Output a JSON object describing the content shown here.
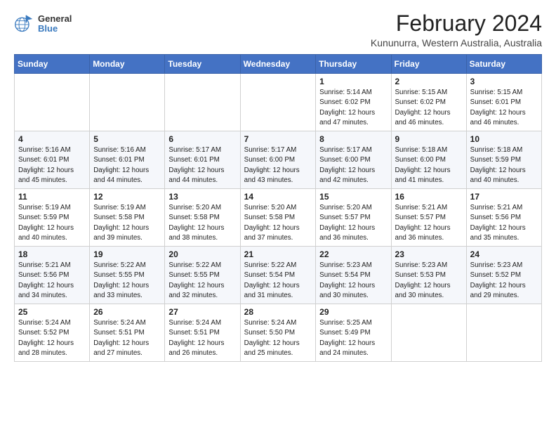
{
  "logo": {
    "line1": "General",
    "line2": "Blue"
  },
  "title": "February 2024",
  "subtitle": "Kununurra, Western Australia, Australia",
  "weekdays": [
    "Sunday",
    "Monday",
    "Tuesday",
    "Wednesday",
    "Thursday",
    "Friday",
    "Saturday"
  ],
  "weeks": [
    [
      {
        "day": "",
        "info": ""
      },
      {
        "day": "",
        "info": ""
      },
      {
        "day": "",
        "info": ""
      },
      {
        "day": "",
        "info": ""
      },
      {
        "day": "1",
        "info": "Sunrise: 5:14 AM\nSunset: 6:02 PM\nDaylight: 12 hours\nand 47 minutes."
      },
      {
        "day": "2",
        "info": "Sunrise: 5:15 AM\nSunset: 6:02 PM\nDaylight: 12 hours\nand 46 minutes."
      },
      {
        "day": "3",
        "info": "Sunrise: 5:15 AM\nSunset: 6:01 PM\nDaylight: 12 hours\nand 46 minutes."
      }
    ],
    [
      {
        "day": "4",
        "info": "Sunrise: 5:16 AM\nSunset: 6:01 PM\nDaylight: 12 hours\nand 45 minutes."
      },
      {
        "day": "5",
        "info": "Sunrise: 5:16 AM\nSunset: 6:01 PM\nDaylight: 12 hours\nand 44 minutes."
      },
      {
        "day": "6",
        "info": "Sunrise: 5:17 AM\nSunset: 6:01 PM\nDaylight: 12 hours\nand 44 minutes."
      },
      {
        "day": "7",
        "info": "Sunrise: 5:17 AM\nSunset: 6:00 PM\nDaylight: 12 hours\nand 43 minutes."
      },
      {
        "day": "8",
        "info": "Sunrise: 5:17 AM\nSunset: 6:00 PM\nDaylight: 12 hours\nand 42 minutes."
      },
      {
        "day": "9",
        "info": "Sunrise: 5:18 AM\nSunset: 6:00 PM\nDaylight: 12 hours\nand 41 minutes."
      },
      {
        "day": "10",
        "info": "Sunrise: 5:18 AM\nSunset: 5:59 PM\nDaylight: 12 hours\nand 40 minutes."
      }
    ],
    [
      {
        "day": "11",
        "info": "Sunrise: 5:19 AM\nSunset: 5:59 PM\nDaylight: 12 hours\nand 40 minutes."
      },
      {
        "day": "12",
        "info": "Sunrise: 5:19 AM\nSunset: 5:58 PM\nDaylight: 12 hours\nand 39 minutes."
      },
      {
        "day": "13",
        "info": "Sunrise: 5:20 AM\nSunset: 5:58 PM\nDaylight: 12 hours\nand 38 minutes."
      },
      {
        "day": "14",
        "info": "Sunrise: 5:20 AM\nSunset: 5:58 PM\nDaylight: 12 hours\nand 37 minutes."
      },
      {
        "day": "15",
        "info": "Sunrise: 5:20 AM\nSunset: 5:57 PM\nDaylight: 12 hours\nand 36 minutes."
      },
      {
        "day": "16",
        "info": "Sunrise: 5:21 AM\nSunset: 5:57 PM\nDaylight: 12 hours\nand 36 minutes."
      },
      {
        "day": "17",
        "info": "Sunrise: 5:21 AM\nSunset: 5:56 PM\nDaylight: 12 hours\nand 35 minutes."
      }
    ],
    [
      {
        "day": "18",
        "info": "Sunrise: 5:21 AM\nSunset: 5:56 PM\nDaylight: 12 hours\nand 34 minutes."
      },
      {
        "day": "19",
        "info": "Sunrise: 5:22 AM\nSunset: 5:55 PM\nDaylight: 12 hours\nand 33 minutes."
      },
      {
        "day": "20",
        "info": "Sunrise: 5:22 AM\nSunset: 5:55 PM\nDaylight: 12 hours\nand 32 minutes."
      },
      {
        "day": "21",
        "info": "Sunrise: 5:22 AM\nSunset: 5:54 PM\nDaylight: 12 hours\nand 31 minutes."
      },
      {
        "day": "22",
        "info": "Sunrise: 5:23 AM\nSunset: 5:54 PM\nDaylight: 12 hours\nand 30 minutes."
      },
      {
        "day": "23",
        "info": "Sunrise: 5:23 AM\nSunset: 5:53 PM\nDaylight: 12 hours\nand 30 minutes."
      },
      {
        "day": "24",
        "info": "Sunrise: 5:23 AM\nSunset: 5:52 PM\nDaylight: 12 hours\nand 29 minutes."
      }
    ],
    [
      {
        "day": "25",
        "info": "Sunrise: 5:24 AM\nSunset: 5:52 PM\nDaylight: 12 hours\nand 28 minutes."
      },
      {
        "day": "26",
        "info": "Sunrise: 5:24 AM\nSunset: 5:51 PM\nDaylight: 12 hours\nand 27 minutes."
      },
      {
        "day": "27",
        "info": "Sunrise: 5:24 AM\nSunset: 5:51 PM\nDaylight: 12 hours\nand 26 minutes."
      },
      {
        "day": "28",
        "info": "Sunrise: 5:24 AM\nSunset: 5:50 PM\nDaylight: 12 hours\nand 25 minutes."
      },
      {
        "day": "29",
        "info": "Sunrise: 5:25 AM\nSunset: 5:49 PM\nDaylight: 12 hours\nand 24 minutes."
      },
      {
        "day": "",
        "info": ""
      },
      {
        "day": "",
        "info": ""
      }
    ]
  ]
}
